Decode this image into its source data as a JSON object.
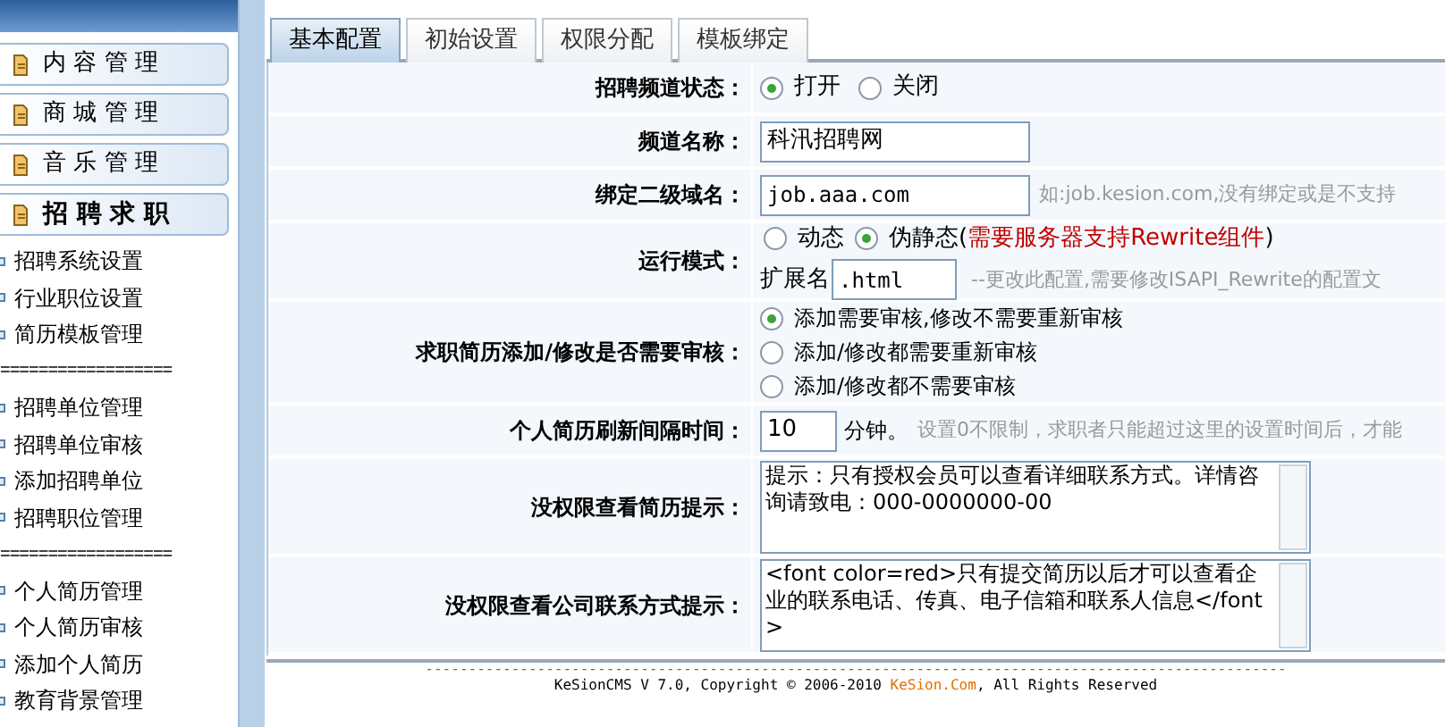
{
  "sidebar": {
    "menus": [
      {
        "label": "内 容 管 理",
        "selected": false
      },
      {
        "label": "商 城 管 理",
        "selected": false
      },
      {
        "label": "音 乐 管 理",
        "selected": false
      },
      {
        "label": "招 聘 求 职",
        "selected": true
      }
    ],
    "items": [
      {
        "kind": "link",
        "label": "招聘系统设置"
      },
      {
        "kind": "link",
        "label": "行业职位设置"
      },
      {
        "kind": "link",
        "label": "简历模板管理"
      },
      {
        "kind": "separator",
        "label": "=================="
      },
      {
        "kind": "link",
        "label": "招聘单位管理"
      },
      {
        "kind": "link",
        "label": "招聘单位审核"
      },
      {
        "kind": "link",
        "label": "添加招聘单位"
      },
      {
        "kind": "link",
        "label": "招聘职位管理"
      },
      {
        "kind": "separator",
        "label": "=================="
      },
      {
        "kind": "link",
        "label": "个人简历管理"
      },
      {
        "kind": "link",
        "label": "个人简历审核"
      },
      {
        "kind": "link",
        "label": "添加个人简历"
      },
      {
        "kind": "link",
        "label": "教育背景管理"
      }
    ]
  },
  "tabs": [
    {
      "label": "基本配置",
      "selected": true
    },
    {
      "label": "初始设置",
      "selected": false
    },
    {
      "label": "权限分配",
      "selected": false
    },
    {
      "label": "模板绑定",
      "selected": false
    }
  ],
  "form": [
    {
      "kind": "radio",
      "label": "招聘频道状态：",
      "options": [
        {
          "label": "打开",
          "selected": true
        },
        {
          "label": "关闭",
          "selected": false
        }
      ]
    },
    {
      "kind": "text",
      "label": "频道名称：",
      "value": "科汛招聘网"
    },
    {
      "kind": "text",
      "label": "绑定二级域名：",
      "value": "job.aaa.com",
      "hint": "如:job.kesion.com,没有绑定或是不支持"
    },
    {
      "kind": "mode",
      "label": "运行模式：",
      "options": [
        {
          "label": "动态",
          "selected": false
        },
        {
          "label": "伪静态",
          "note": "(**需要服务器支持Rewrite组件**)",
          "selected": true
        }
      ],
      "ext_label": "扩展名",
      "ext_value": ".html",
      "hint": "--更改此配置,需要修改ISAPI_Rewrite的配置文"
    },
    {
      "kind": "radiolist",
      "label": "求职简历添加/修改是否需要审核：",
      "options": [
        {
          "label": "添加需要审核,修改不需要重新审核",
          "selected": true
        },
        {
          "label": "添加/修改都需要重新审核",
          "selected": false
        },
        {
          "label": "添加/修改都不需要审核",
          "selected": false
        }
      ]
    },
    {
      "kind": "number",
      "label": "个人简历刷新间隔时间：",
      "value": "10",
      "unit": "分钟。",
      "hint": "设置0不限制，求职者只能超过这里的设置时间后，才能"
    },
    {
      "kind": "textarea",
      "label": "没权限查看简历提示：",
      "value": "提示：只有授权会员可以查看详细联系方式。详情咨询请致电：000-0000000-00"
    },
    {
      "kind": "textarea",
      "label": "没权限查看公司联系方式提示：",
      "value": "<font color=red>只有提交简历以后才可以查看企业的联系电话、传真、电子信箱和联系人信息</font>"
    }
  ],
  "footer": {
    "dashes": "----------------------------------------------------------------------------------------------------",
    "text": "KeSionCMS V 7.0, Copyright © 2006-2010",
    "link": "KeSion.Com",
    "text_after": ", All Rights Reserved"
  }
}
